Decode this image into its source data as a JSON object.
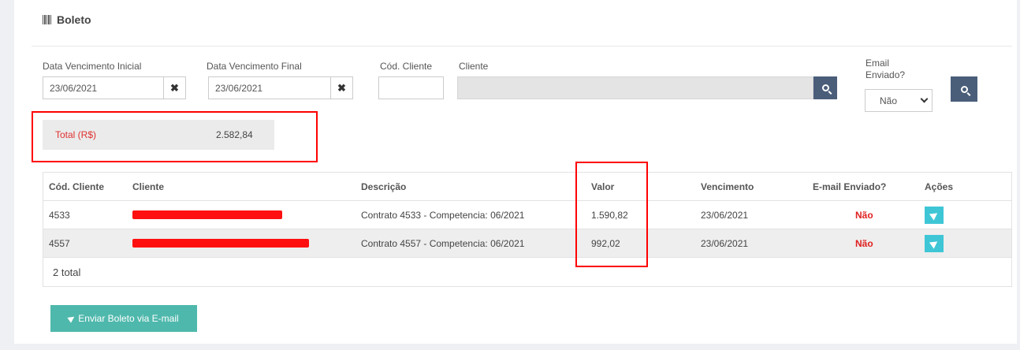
{
  "panel": {
    "title": "Boleto",
    "icon": "barcode-icon"
  },
  "filters": {
    "data_inicial_label": "Data Vencimento Inicial",
    "data_inicial_value": "23/06/2021",
    "data_final_label": "Data Vencimento Final",
    "data_final_value": "23/06/2021",
    "cod_cliente_label": "Cód. Cliente",
    "cod_cliente_value": "",
    "cliente_label": "Cliente",
    "cliente_value": "",
    "email_enviado_label_line1": "Email",
    "email_enviado_label_line2": "Enviado?",
    "email_enviado_value": "Não",
    "clear_glyph": "✖"
  },
  "summary": {
    "label": "Total (R$)",
    "value": "2.582,84"
  },
  "table": {
    "columns": [
      "Cód. Cliente",
      "Cliente",
      "Descrição",
      "Valor",
      "Vencimento",
      "E-mail Enviado?",
      "Ações"
    ],
    "rows": [
      {
        "cod": "4533",
        "cliente": "",
        "descricao": "Contrato 4533 - Competencia: 06/2021",
        "valor": "1.590,82",
        "vencimento": "23/06/2021",
        "email_enviado": "Não"
      },
      {
        "cod": "4557",
        "cliente": "",
        "descricao": "Contrato 4557 - Competencia: 06/2021",
        "valor": "992,02",
        "vencimento": "23/06/2021",
        "email_enviado": "Não"
      }
    ],
    "total_text": "2 total"
  },
  "actions": {
    "send_all_label": "Enviar Boleto via E-mail"
  },
  "colors": {
    "accent_button": "#4fb8ac",
    "search_button": "#4a5e7a",
    "action_button": "#3fc6d6",
    "highlight": "#ff0000",
    "status_no": "#e02020"
  }
}
